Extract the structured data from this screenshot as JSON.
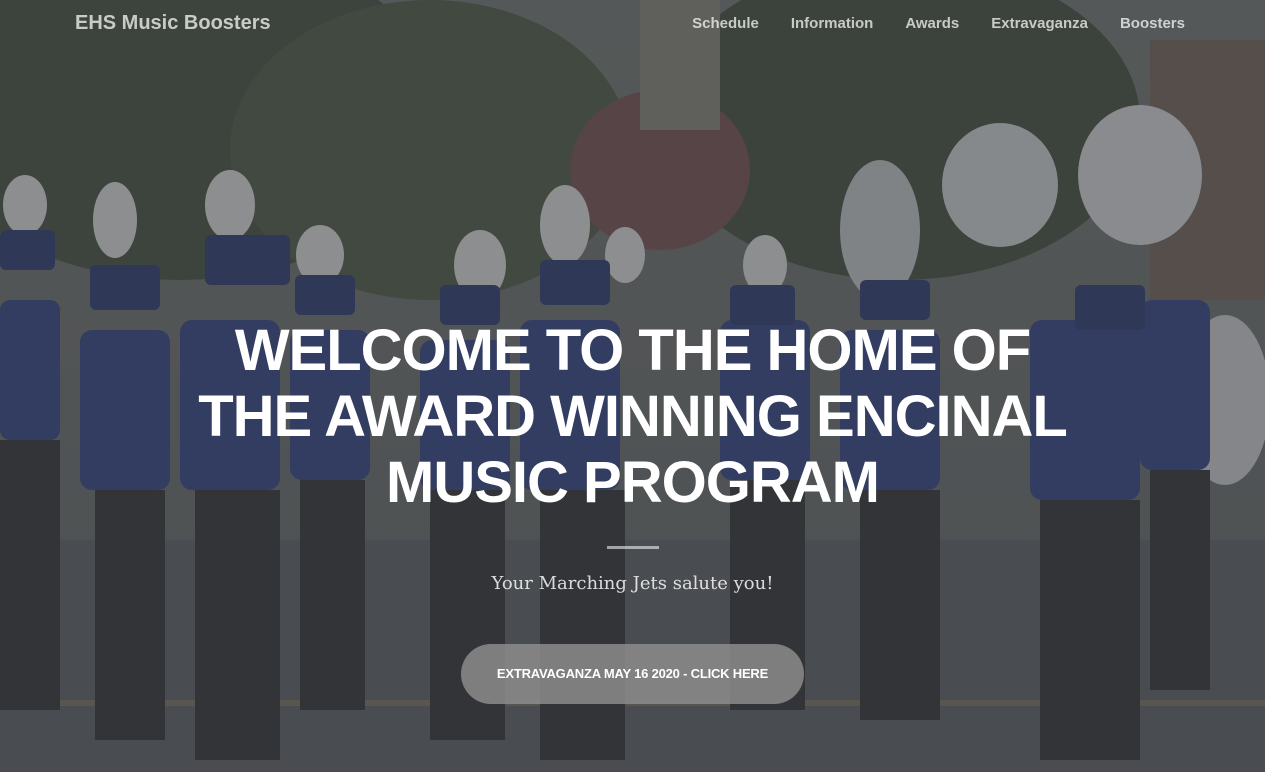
{
  "navbar": {
    "brand": "EHS Music Boosters",
    "links": [
      "Schedule",
      "Information",
      "Awards",
      "Extravaganza",
      "Boosters"
    ]
  },
  "hero": {
    "title": "WELCOME TO THE HOME OF THE AWARD WINNING ENCINAL MUSIC PROGRAM",
    "subtitle": "Your Marching Jets salute you!",
    "cta_label": "EXTRAVAGANZA MAY 16 2020 - CLICK HERE"
  },
  "colors": {
    "overlay": "#3c3e42",
    "button": "#8c8c8c",
    "text": "#ffffff",
    "uniform_blue": "#2a3d7a"
  },
  "background_image": "marching-band-photo"
}
